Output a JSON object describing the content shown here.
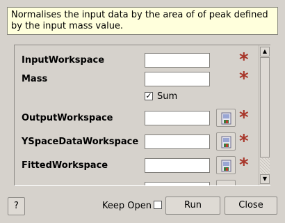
{
  "description": "Normalises the input data by the area of of peak defined by the input mass value.",
  "fields": {
    "input_workspace": {
      "label": "InputWorkspace",
      "value": "",
      "required_mark": "*"
    },
    "mass": {
      "label": "Mass",
      "value": "",
      "required_mark": "*"
    },
    "sum": {
      "label": "Sum",
      "checked": true,
      "check_glyph": "✓"
    },
    "output_workspace": {
      "label": "OutputWorkspace",
      "value": "",
      "required_mark": "*"
    },
    "yspace_data_workspace": {
      "label": "YSpaceDataWorkspace",
      "value": "",
      "required_mark": "*"
    },
    "fitted_workspace": {
      "label": "FittedWorkspace",
      "value": "",
      "required_mark": "*"
    }
  },
  "icons": {
    "browse": "save-workspace-icon",
    "scroll_up": "▲",
    "scroll_down": "▼"
  },
  "footer": {
    "help_label": "?",
    "keep_open_label": "Keep Open",
    "keep_open_checked": false,
    "run_label": "Run",
    "close_label": "Close"
  },
  "colors": {
    "required_star": "#a8362a",
    "description_bg": "#ffffdc",
    "window_bg": "#d6d2cc"
  }
}
